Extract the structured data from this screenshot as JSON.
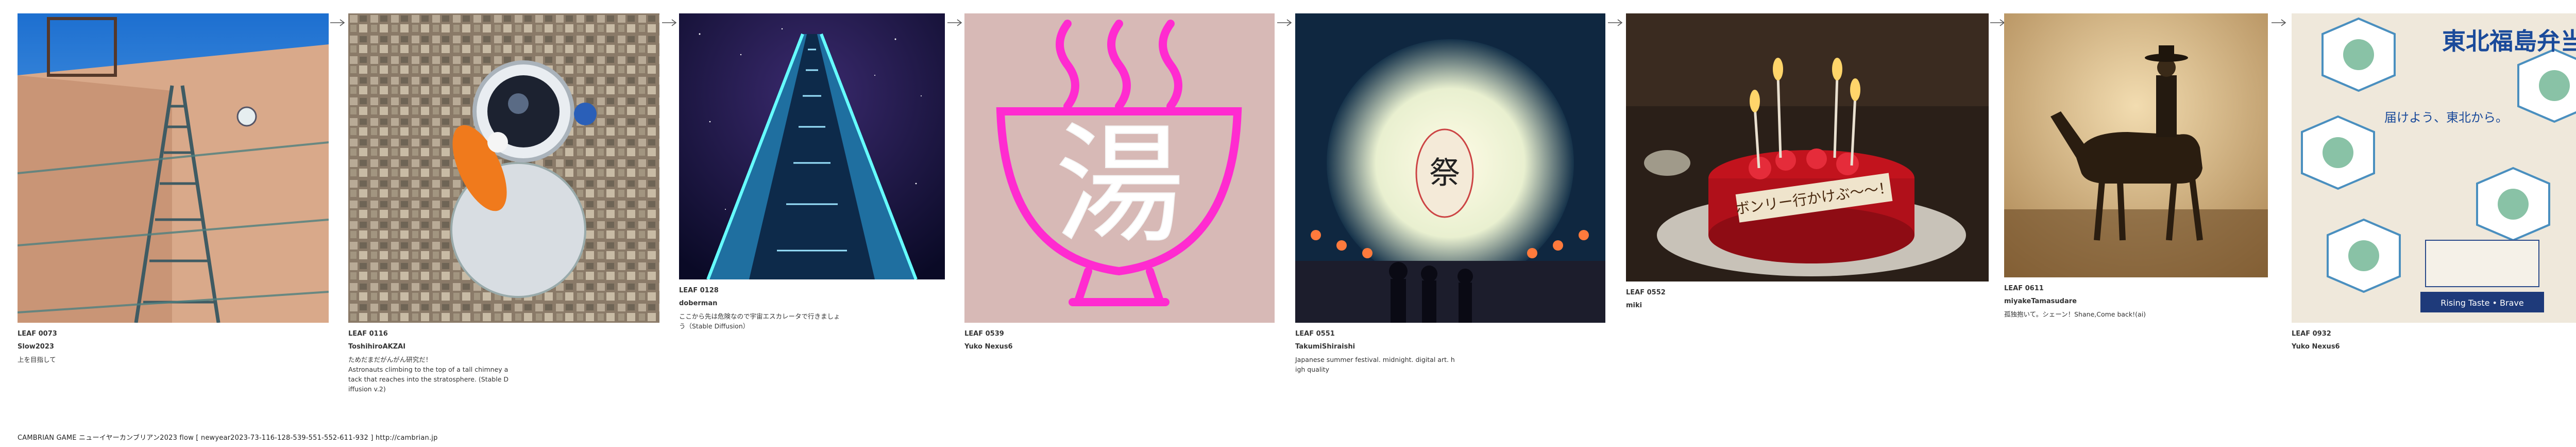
{
  "cards": [
    {
      "leaf": "LEAF 0073",
      "author": "Slow2023",
      "prompt": "上を目指して"
    },
    {
      "leaf": "LEAF 0116",
      "author": "ToshihiroAKZAI",
      "prompt": "ためだまだがんがん研究だ！\nAstronauts climbing to the top of a tall chimney a\ntack that reaches into the stratosphere. (Stable D\niffusion v.2)"
    },
    {
      "leaf": "LEAF 0128",
      "author": "doberman",
      "prompt": "ここから先は危険なので宇宙エスカレータで行きましょ\nう（Stable Diffusion）"
    },
    {
      "leaf": "LEAF 0539",
      "author": "Yuko Nexus6",
      "prompt": ""
    },
    {
      "leaf": "LEAF 0551",
      "author": "TakumiShiraishi",
      "prompt": "Japanese summer festival. midnight. digital art. h\nigh quality"
    },
    {
      "leaf": "LEAF 0552",
      "author": "miki",
      "prompt": ""
    },
    {
      "leaf": "LEAF 0611",
      "author": "miyakeTamasudare",
      "prompt": "孤独抱いて。シェーン！Shane,Come back!(ai)"
    },
    {
      "leaf": "LEAF 0932",
      "author": "Yuko Nexus6",
      "prompt": ""
    }
  ],
  "footer": "CAMBRIAN GAME  ニューイヤーカンブリアン2023  flow [ newyear2023-73-116-128-539-551-552-611-932 ]    http://cambrian.jp",
  "image_text": {
    "onsen_kanji": "湯",
    "cake_plate": "ボンリー行かけぶ～～！",
    "bento_title": "東北福島弁当",
    "bento_sub": "届けよう、東北から。",
    "bento_label": "Rising Taste • Brave"
  }
}
